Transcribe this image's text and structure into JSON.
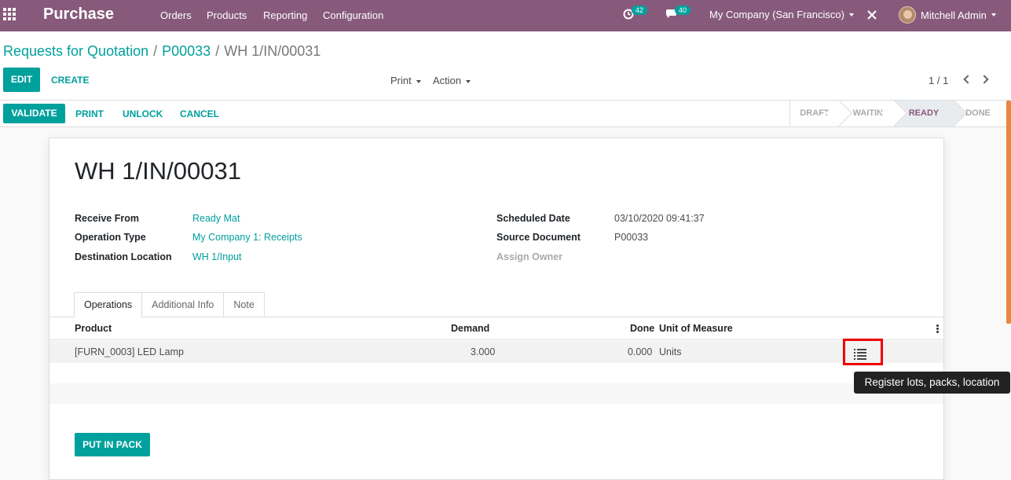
{
  "navbar": {
    "app_title": "Purchase",
    "menu": [
      "Orders",
      "Products",
      "Reporting",
      "Configuration"
    ],
    "activity_count": "42",
    "message_count": "40",
    "company": "My Company (San Francisco)",
    "user": "Mitchell Admin"
  },
  "breadcrumb": {
    "root": "Requests for Quotation",
    "parent": "P00033",
    "current": "WH 1/IN/00031",
    "separator": "/"
  },
  "control": {
    "edit_label": "EDIT",
    "create_label": "CREATE",
    "print_label": "Print",
    "action_label": "Action",
    "pager": "1 / 1"
  },
  "header_buttons": {
    "validate": "VALIDATE",
    "print": "PRINT",
    "unlock": "UNLOCK",
    "cancel": "CANCEL"
  },
  "status": {
    "stages": [
      "DRAFT",
      "WAITING",
      "READY",
      "DONE"
    ],
    "active": "READY"
  },
  "form": {
    "title": "WH 1/IN/00031",
    "receive_from_label": "Receive From",
    "receive_from": "Ready Mat",
    "operation_type_label": "Operation Type",
    "operation_type": "My Company 1: Receipts",
    "destination_label": "Destination Location",
    "destination": "WH 1/Input",
    "scheduled_date_label": "Scheduled Date",
    "scheduled_date": "03/10/2020 09:41:37",
    "source_document_label": "Source Document",
    "source_document": "P00033",
    "assign_owner_label": "Assign Owner"
  },
  "tabs": [
    "Operations",
    "Additional Info",
    "Note"
  ],
  "table": {
    "columns": [
      "Product",
      "Demand",
      "Done",
      "Unit of Measure"
    ],
    "rows": [
      {
        "product": "[FURN_0003] LED Lamp",
        "demand": "3.000",
        "done": "0.000",
        "uom": "Units"
      }
    ]
  },
  "put_in_pack_label": "PUT IN PACK",
  "tooltip": "Register lots, packs, location",
  "colors": {
    "brand": "#875a7b",
    "accent": "#00a09d",
    "highlight_box": "#e00000"
  }
}
